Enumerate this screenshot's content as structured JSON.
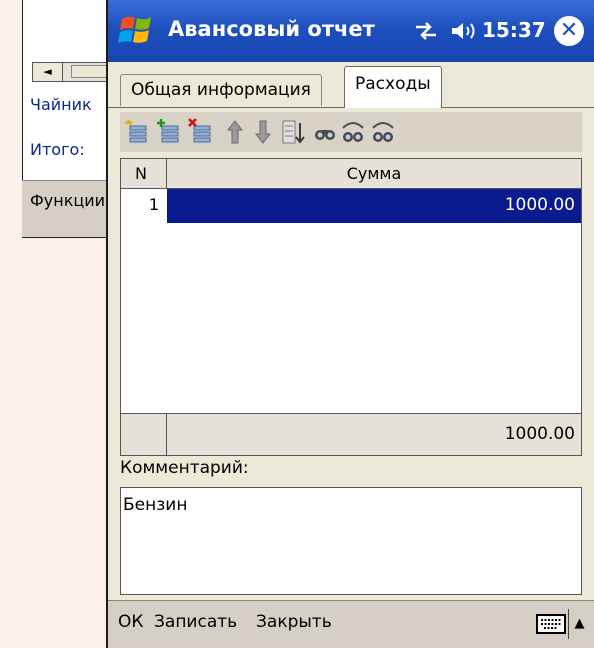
{
  "background_window": {
    "item_label": "Чайник",
    "total_label": "Итого:",
    "menu_label": "Функции",
    "scroll_left_glyph": "◄"
  },
  "title_bar": {
    "title": "Авансовый отчет",
    "time": "15:37",
    "close_glyph": "✕",
    "icons": [
      "windows-start-icon",
      "connectivity-icon",
      "volume-icon"
    ]
  },
  "tabs": [
    {
      "label": "Общая информация",
      "active": false
    },
    {
      "label": "Расходы",
      "active": true
    }
  ],
  "toolbar": {
    "icons": [
      "add-row-icon",
      "insert-row-icon",
      "delete-row-icon",
      "move-up-icon",
      "move-down-icon",
      "sort-filter-icon",
      "find-icon",
      "find-previous-icon",
      "find-next-icon"
    ]
  },
  "grid": {
    "columns": [
      "N",
      "Сумма"
    ],
    "rows": [
      {
        "n": "1",
        "sum": "1000.00",
        "selected": true
      }
    ],
    "total": "1000.00"
  },
  "comment": {
    "label": "Комментарий:",
    "value": "Бензин"
  },
  "menu_bar": {
    "ok": "ОК",
    "save": "Записать",
    "close": "Закрыть",
    "sip_arrow": "▲"
  },
  "colors": {
    "title_bar": "#1e4fbf",
    "selection": "#0a1a8f",
    "chrome": "#ece9d8",
    "menu_bar": "#d6cfc6"
  }
}
